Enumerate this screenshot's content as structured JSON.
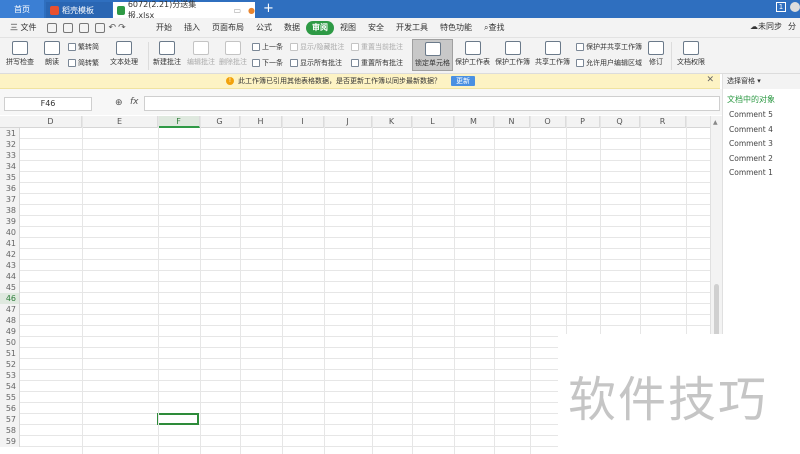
{
  "titlebar": {
    "home_tab": "首页",
    "template_tab": "稻壳模板",
    "file_tab": "6072(2.21)分送集报.xlsx",
    "add_tab": "+",
    "right_badge": "1",
    "right_badge2": "分"
  },
  "menubar": {
    "file_label": "三 文件",
    "items": [
      "开始",
      "插入",
      "页面布局",
      "公式",
      "数据",
      "审阅",
      "视图",
      "安全",
      "开发工具",
      "特色功能",
      "查找"
    ],
    "active_index": 5,
    "sync": "未同步",
    "collab": "分"
  },
  "ribbon": {
    "spell": "拼写检查",
    "read": "朗读",
    "trad2simp": "繁转简",
    "simp2trad": "简转繁",
    "text_proc": "文本处理",
    "new_comment": "新建批注",
    "edit_comment": "编辑批注",
    "delete_comment": "删除批注",
    "prev": "上一条",
    "next": "下一条",
    "show_hide": "显示/隐藏批注",
    "show_all": "显示所有批注",
    "reset_current": "重置当前批注",
    "reset_all": "重置所有批注",
    "lock_cell": "锁定单元格",
    "protect_sheet": "保护工作表",
    "protect_book": "保护工作簿",
    "share_book": "共享工作簿",
    "protect_share": "保护并共享工作簿",
    "allow_edit": "允许用户编辑区域",
    "revise": "修订",
    "doc_perm": "文档权限"
  },
  "notify": {
    "message": "此工作簿已引用其他表格数据，是否更新工作簿以同步最新数据？",
    "button": "更新",
    "close": "✕"
  },
  "formulabar": {
    "cell_ref": "F46",
    "fx": "fx",
    "zoom": "⊕"
  },
  "grid": {
    "columns": [
      "D",
      "E",
      "F",
      "G",
      "H",
      "I",
      "J",
      "K",
      "L",
      "M",
      "N",
      "O",
      "P",
      "Q",
      "R"
    ],
    "active_column": "F",
    "rows": [
      "31",
      "32",
      "33",
      "34",
      "35",
      "36",
      "37",
      "38",
      "39",
      "40",
      "41",
      "42",
      "43",
      "44",
      "45",
      "46",
      "47",
      "48",
      "49",
      "50",
      "51",
      "52",
      "53",
      "54",
      "55",
      "56",
      "57",
      "58",
      "59"
    ],
    "active_row": "46"
  },
  "rightpane": {
    "header": "选择窗格 ▾",
    "title": "文档中的对象",
    "items": [
      "Comment 5",
      "Comment 4",
      "Comment 3",
      "Comment 2",
      "Comment 1"
    ]
  },
  "watermark": "软件技巧"
}
